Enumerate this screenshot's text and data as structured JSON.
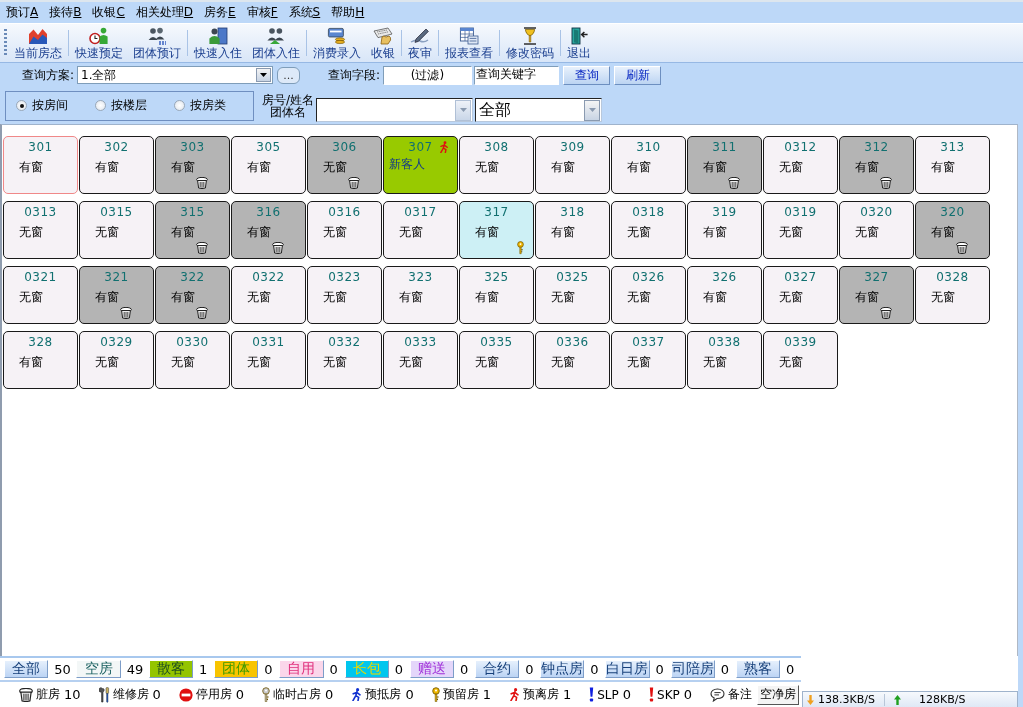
{
  "menu": [
    {
      "label": "预订",
      "accelerator": "A"
    },
    {
      "label": "接待",
      "accelerator": "B"
    },
    {
      "label": "收银",
      "accelerator": "C"
    },
    {
      "label": "相关处理",
      "accelerator": "D"
    },
    {
      "label": "房务",
      "accelerator": "E"
    },
    {
      "label": "审核",
      "accelerator": "F"
    },
    {
      "label": "系统",
      "accelerator": "S"
    },
    {
      "label": "帮助",
      "accelerator": "H"
    }
  ],
  "toolbar": [
    [
      "当前房态"
    ],
    [
      "快速预定",
      "团体预订"
    ],
    [
      "快速入住",
      "团体入住"
    ],
    [
      "消费录入",
      "收银"
    ],
    [
      "夜审"
    ],
    [
      "报表查看"
    ],
    [
      "修改密码"
    ],
    [
      "退出"
    ]
  ],
  "query": {
    "scheme_label": "查询方案:",
    "scheme": "1.全部",
    "more_button": "...",
    "field_label": "查询字段:",
    "field": "(过滤)",
    "keyword": "查询关键字",
    "search_button": "查询",
    "refresh_button": "刷新"
  },
  "view": {
    "radios": [
      {
        "label": "按房间",
        "selected": true
      },
      {
        "label": "按楼层",
        "selected": false
      },
      {
        "label": "按房类",
        "selected": false
      }
    ],
    "search_label": [
      "房号/姓名",
      "团体名"
    ],
    "room_type": "全部"
  },
  "rooms": [
    {
      "number": "301",
      "label": "有窗",
      "kind": "vacant",
      "selected": true
    },
    {
      "number": "302",
      "label": "有窗",
      "kind": "vacant",
      "selected": false
    },
    {
      "number": "303",
      "label": "有窗",
      "kind": "dirty",
      "selected": false
    },
    {
      "number": "305",
      "label": "有窗",
      "kind": "vacant",
      "selected": false
    },
    {
      "number": "306",
      "label": "无窗",
      "kind": "dirty",
      "selected": false
    },
    {
      "number": "307",
      "label": "新客人",
      "kind": "due_out",
      "selected": false
    },
    {
      "number": "308",
      "label": "无窗",
      "kind": "vacant",
      "selected": false
    },
    {
      "number": "309",
      "label": "有窗",
      "kind": "vacant",
      "selected": false
    },
    {
      "number": "310",
      "label": "有窗",
      "kind": "vacant",
      "selected": false
    },
    {
      "number": "311",
      "label": "有窗",
      "kind": "dirty",
      "selected": false
    },
    {
      "number": "0312",
      "label": "无窗",
      "kind": "vacant",
      "selected": false
    },
    {
      "number": "312",
      "label": "有窗",
      "kind": "dirty",
      "selected": false
    },
    {
      "number": "313",
      "label": "有窗",
      "kind": "vacant",
      "selected": false
    },
    {
      "number": "0313",
      "label": "无窗",
      "kind": "vacant",
      "selected": false
    },
    {
      "number": "0315",
      "label": "无窗",
      "kind": "vacant",
      "selected": false
    },
    {
      "number": "315",
      "label": "有窗",
      "kind": "dirty",
      "selected": false
    },
    {
      "number": "316",
      "label": "有窗",
      "kind": "dirty",
      "selected": false
    },
    {
      "number": "0316",
      "label": "无窗",
      "kind": "vacant",
      "selected": false
    },
    {
      "number": "0317",
      "label": "无窗",
      "kind": "vacant",
      "selected": false
    },
    {
      "number": "317",
      "label": "有窗",
      "kind": "reserved",
      "selected": false
    },
    {
      "number": "318",
      "label": "有窗",
      "kind": "vacant",
      "selected": false
    },
    {
      "number": "0318",
      "label": "无窗",
      "kind": "vacant",
      "selected": false
    },
    {
      "number": "319",
      "label": "有窗",
      "kind": "vacant",
      "selected": false
    },
    {
      "number": "0319",
      "label": "无窗",
      "kind": "vacant",
      "selected": false
    },
    {
      "number": "0320",
      "label": "无窗",
      "kind": "vacant",
      "selected": false
    },
    {
      "number": "320",
      "label": "有窗",
      "kind": "dirty",
      "selected": false
    },
    {
      "number": "0321",
      "label": "无窗",
      "kind": "vacant",
      "selected": false
    },
    {
      "number": "321",
      "label": "有窗",
      "kind": "dirty",
      "selected": false
    },
    {
      "number": "322",
      "label": "有窗",
      "kind": "dirty",
      "selected": false
    },
    {
      "number": "0322",
      "label": "无窗",
      "kind": "vacant",
      "selected": false
    },
    {
      "number": "0323",
      "label": "无窗",
      "kind": "vacant",
      "selected": false
    },
    {
      "number": "323",
      "label": "有窗",
      "kind": "vacant",
      "selected": false
    },
    {
      "number": "325",
      "label": "有窗",
      "kind": "vacant",
      "selected": false
    },
    {
      "number": "0325",
      "label": "无窗",
      "kind": "vacant",
      "selected": false
    },
    {
      "number": "0326",
      "label": "无窗",
      "kind": "vacant",
      "selected": false
    },
    {
      "number": "326",
      "label": "有窗",
      "kind": "vacant",
      "selected": false
    },
    {
      "number": "0327",
      "label": "无窗",
      "kind": "vacant",
      "selected": false
    },
    {
      "number": "327",
      "label": "有窗",
      "kind": "dirty",
      "selected": false
    },
    {
      "number": "0328",
      "label": "无窗",
      "kind": "vacant",
      "selected": false
    },
    {
      "number": "328",
      "label": "有窗",
      "kind": "vacant",
      "selected": false
    },
    {
      "number": "0329",
      "label": "无窗",
      "kind": "vacant",
      "selected": false
    },
    {
      "number": "0330",
      "label": "无窗",
      "kind": "vacant",
      "selected": false
    },
    {
      "number": "0331",
      "label": "无窗",
      "kind": "vacant",
      "selected": false
    },
    {
      "number": "0332",
      "label": "无窗",
      "kind": "vacant",
      "selected": false
    },
    {
      "number": "0333",
      "label": "无窗",
      "kind": "vacant",
      "selected": false
    },
    {
      "number": "0335",
      "label": "无窗",
      "kind": "vacant",
      "selected": false
    },
    {
      "number": "0336",
      "label": "无窗",
      "kind": "vacant",
      "selected": false
    },
    {
      "number": "0337",
      "label": "无窗",
      "kind": "vacant",
      "selected": false
    },
    {
      "number": "0338",
      "label": "无窗",
      "kind": "vacant",
      "selected": false
    },
    {
      "number": "0339",
      "label": "无窗",
      "kind": "vacant",
      "selected": false
    }
  ],
  "legend": [
    {
      "label": "全部",
      "count": "50",
      "kind": "plain"
    },
    {
      "label": "空房",
      "count": "49",
      "kind": "vacant",
      "color": "#f3f7f7"
    },
    {
      "label": "散客",
      "count": "1",
      "kind": "walk_in",
      "color": "#94c400"
    },
    {
      "label": "团体",
      "count": "0",
      "kind": "group",
      "color": "#f8c400"
    },
    {
      "label": "自用",
      "count": "0",
      "kind": "own_use",
      "color": "#fbd6ea"
    },
    {
      "label": "长包",
      "count": "0",
      "kind": "long_stay",
      "color": "#00c6ee"
    },
    {
      "label": "赠送",
      "count": "0",
      "kind": "complimentary",
      "color": "#e4d6fa"
    },
    {
      "label": "合约",
      "count": "0",
      "kind": "plain"
    },
    {
      "label": "钟点房",
      "count": "0",
      "kind": "plain"
    },
    {
      "label": "白日房",
      "count": "0",
      "kind": "plain"
    },
    {
      "label": "司陪房",
      "count": "0",
      "kind": "plain"
    },
    {
      "label": "熟客",
      "count": "0",
      "kind": "plain"
    }
  ],
  "status_items": [
    {
      "kind": "dirty",
      "label": "脏房",
      "count": "10"
    },
    {
      "kind": "maintenance",
      "label": "维修房",
      "count": "0"
    },
    {
      "kind": "out_of_service",
      "label": "停用房",
      "count": "0"
    },
    {
      "kind": "temporary",
      "label": "临时占房",
      "count": "0"
    },
    {
      "kind": "arriving",
      "label": "预抵房",
      "count": "0"
    },
    {
      "kind": "reserved",
      "label": "预留房",
      "count": "1"
    },
    {
      "kind": "departing",
      "label": "预离房",
      "count": "1"
    },
    {
      "kind": "slp",
      "label": "SLP",
      "count": "0"
    },
    {
      "kind": "skp",
      "label": "SKP",
      "count": "0"
    },
    {
      "kind": "note",
      "label": "备注"
    }
  ],
  "clean_button": "空净房",
  "network": {
    "down": "138.3KB/S",
    "up": "128KB/S"
  }
}
